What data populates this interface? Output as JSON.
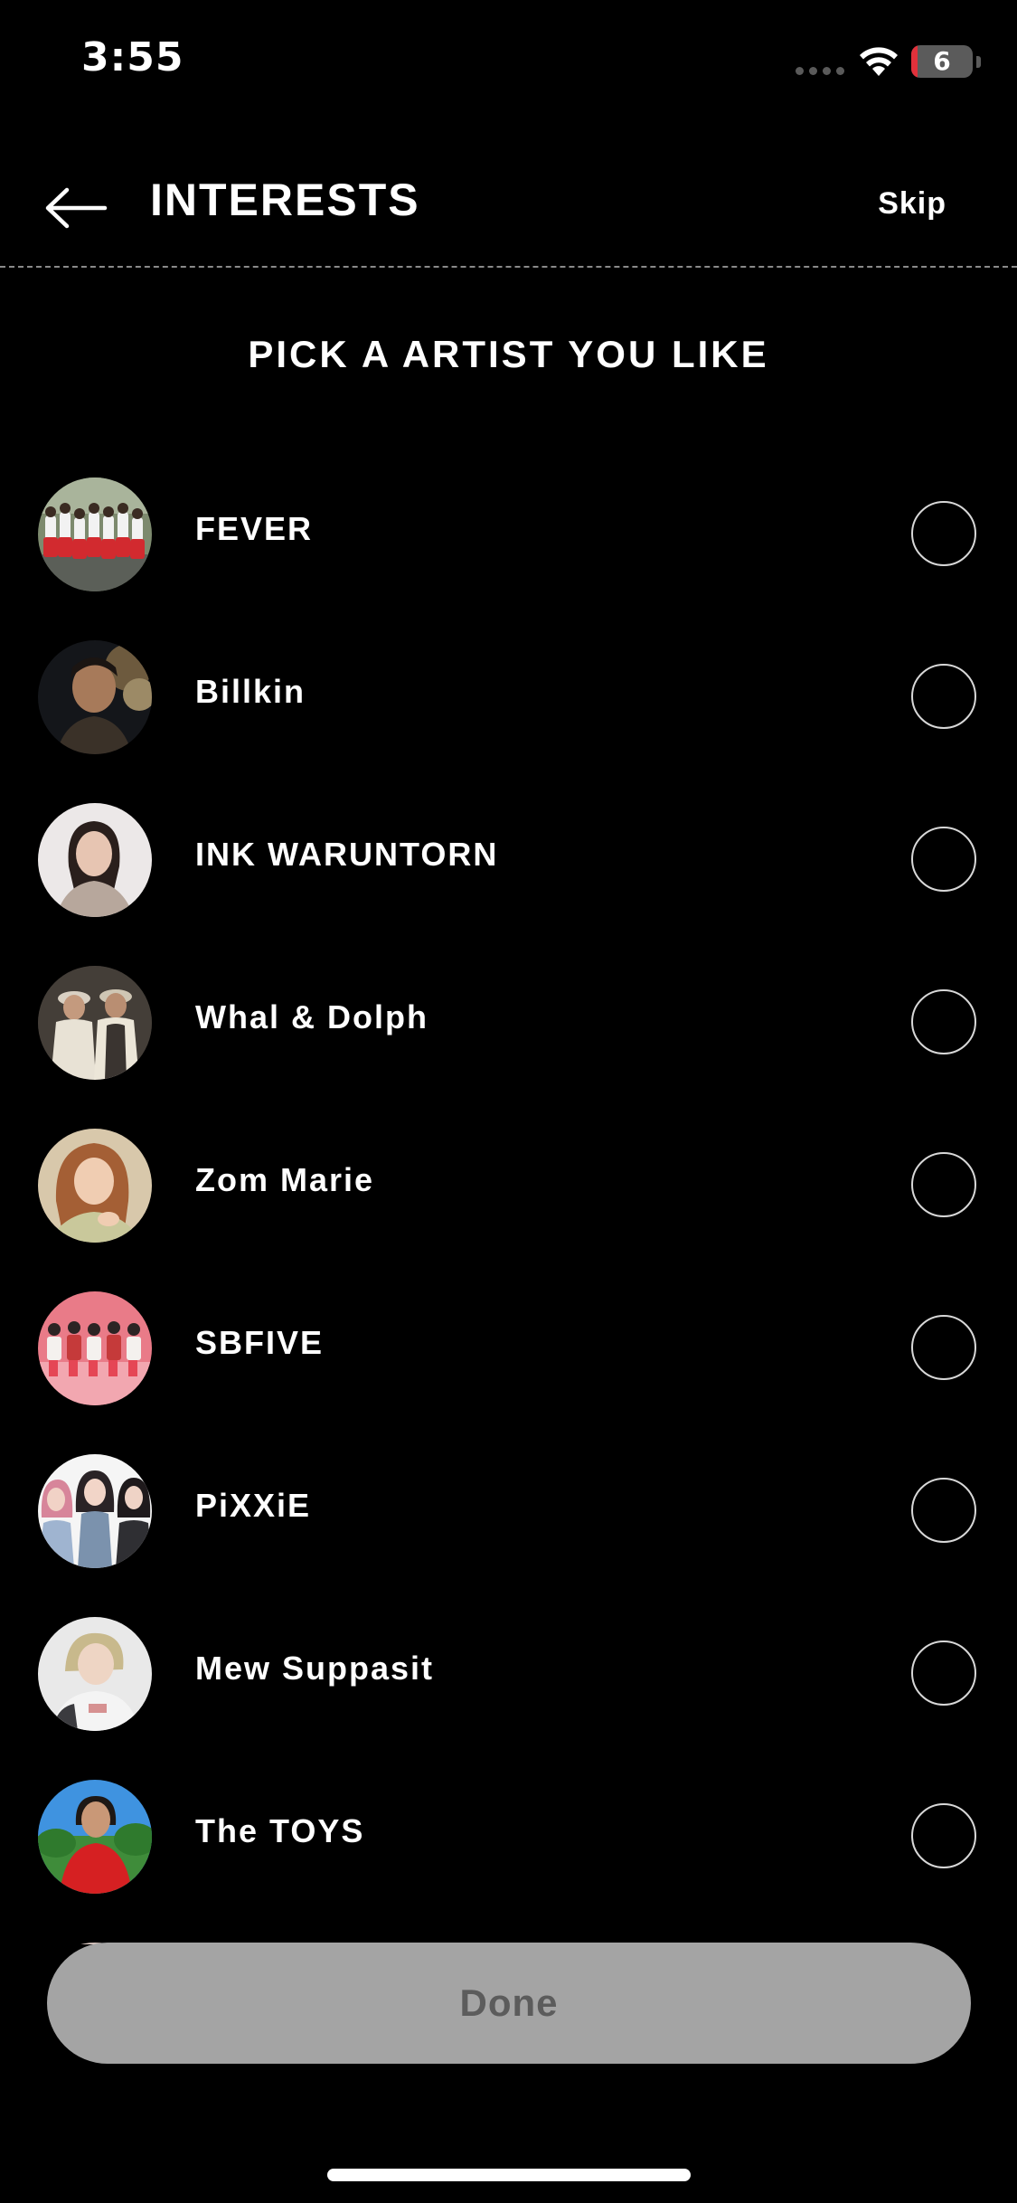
{
  "status_bar": {
    "time": "3:55",
    "battery_level": "6",
    "battery_fraction": 0.06
  },
  "header": {
    "title": "INTERESTS",
    "skip_label": "Skip",
    "back_icon": "arrow-left-icon"
  },
  "subtitle": "PICK A ARTIST YOU LIKE",
  "artists": [
    {
      "name": "FEVER",
      "selected": false
    },
    {
      "name": "Billkin",
      "selected": false
    },
    {
      "name": "INK WARUNTORN",
      "selected": false
    },
    {
      "name": "Whal & Dolph",
      "selected": false
    },
    {
      "name": "Zom Marie",
      "selected": false
    },
    {
      "name": "SBFIVE",
      "selected": false
    },
    {
      "name": "PiXXiE",
      "selected": false
    },
    {
      "name": "Mew Suppasit",
      "selected": false
    },
    {
      "name": "The TOYS",
      "selected": false
    }
  ],
  "done_label": "Done",
  "colors": {
    "background": "#000000",
    "text": "#ffffff",
    "done_button_bg": "#a4a4a4",
    "done_button_text": "#5c5c5c",
    "radio_border": "#d8d8d8",
    "battery_low": "#e2313b"
  }
}
